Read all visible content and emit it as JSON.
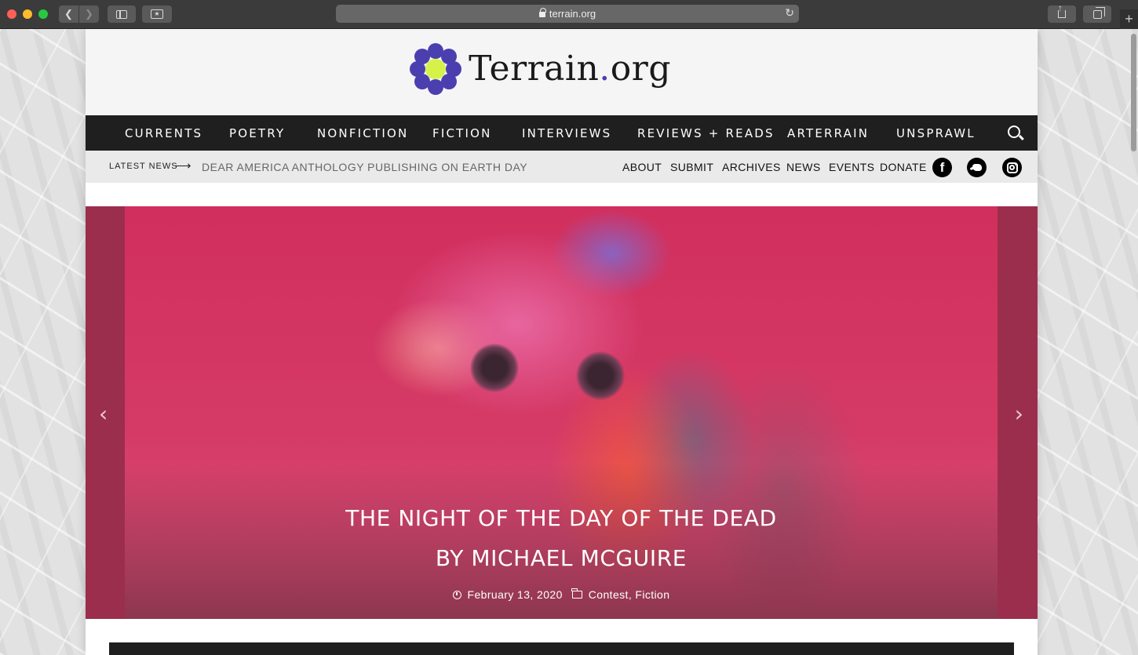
{
  "browser": {
    "url": "terrain.org"
  },
  "site": {
    "logo_text": "Terrain",
    "logo_dot": ".",
    "logo_suffix": "org",
    "colors": {
      "brand_purple": "#4b3fb0",
      "brand_lime": "#d6f24a",
      "nav_bg": "#1f1f1f",
      "subbar_bg": "#eaeaea"
    }
  },
  "mainnav": {
    "items": [
      "CURRENTS",
      "POETRY",
      "NONFICTION",
      "FICTION",
      "INTERVIEWS",
      "REVIEWS + READS",
      "ARTERRAIN",
      "UNSPRAWL"
    ],
    "search_icon": "search-icon"
  },
  "subbar": {
    "latest_label": "LATEST NEWS",
    "latest_arrow": "⟶",
    "latest_headline": "DEAR AMERICA ANTHOLOGY PUBLISHING ON EARTH DAY",
    "links": [
      "ABOUT",
      "SUBMIT",
      "ARCHIVES",
      "NEWS",
      "EVENTS",
      "DONATE"
    ],
    "social": [
      "facebook-icon",
      "twitter-icon",
      "instagram-icon"
    ],
    "fb_glyph": "f"
  },
  "slider": {
    "title_line1": "THE NIGHT OF THE DAY OF THE DEAD",
    "title_line2": "BY MICHAEL MCGUIRE",
    "date": "February 13, 2020",
    "categories": "Contest, Fiction",
    "prev_glyph": "‹",
    "next_glyph": "›"
  }
}
